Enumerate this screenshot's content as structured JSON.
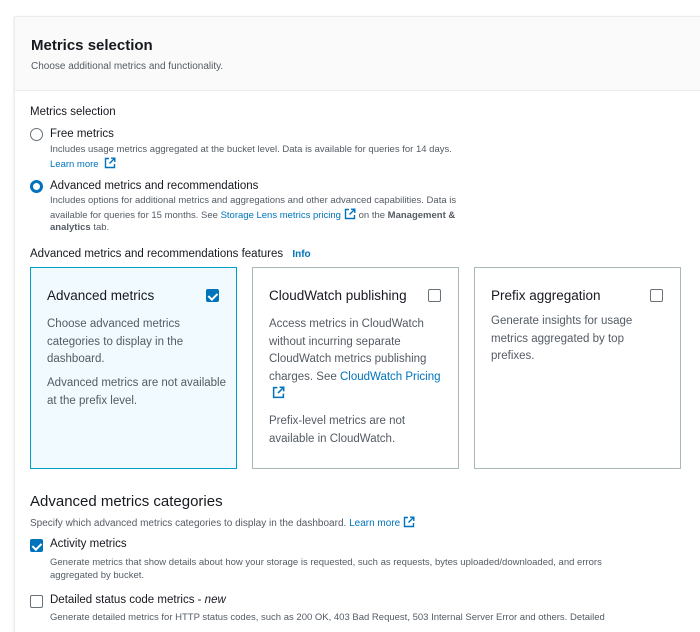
{
  "header": {
    "title": "Metrics selection",
    "description": "Choose additional metrics and functionality."
  },
  "metrics_selection": {
    "label": "Metrics selection",
    "options": [
      {
        "label": "Free metrics",
        "description": "Includes usage metrics aggregated at the bucket level. Data is available for queries for 14 days.",
        "link": "Learn more",
        "selected": false
      },
      {
        "label": "Advanced metrics and recommendations",
        "description_line1": "Includes options for additional metrics and aggregations and other advanced capabilities. Data is",
        "description_line2_pre": "available for queries for 15 months. See",
        "description_link": "Storage Lens metrics pricing",
        "description_line2_post": "on the",
        "description_bold": "Management &",
        "description_line3_bold": "analytics",
        "description_line3_post": "tab.",
        "selected": true
      }
    ]
  },
  "features": {
    "label": "Advanced metrics and recommendations features",
    "info": "Info",
    "tiles": [
      {
        "title": "Advanced metrics",
        "checked": true,
        "body1": "Choose advanced metrics categories to display in the dashboard.",
        "body2": "Advanced metrics are not available at the prefix level."
      },
      {
        "title": "CloudWatch publishing",
        "checked": false,
        "body1_pre": "Access metrics in CloudWatch without incurring separate CloudWatch metrics publishing charges. See",
        "body1_link": "CloudWatch Pricing",
        "body2": "Prefix-level metrics are not available in CloudWatch."
      },
      {
        "title": "Prefix aggregation",
        "checked": false,
        "body1": "Generate insights for usage metrics aggregated by top prefixes."
      }
    ]
  },
  "categories": {
    "title": "Advanced metrics categories",
    "description": "Specify which advanced metrics categories to display in the dashboard.",
    "link": "Learn more",
    "items": [
      {
        "label": "Activity metrics",
        "checked": true,
        "description_line1": "Generate metrics that show details about how your storage is requested, such as requests, bytes uploaded/downloaded, and errors",
        "description_line2": "aggregated by bucket."
      },
      {
        "label": "Detailed status code metrics - ",
        "label_italic": "new",
        "checked": false,
        "description_line1": "Generate detailed metrics for HTTP status codes, such as 200 OK, 403 Bad Request, 503 Internal Server Error and others. Detailed"
      }
    ]
  },
  "colors": {
    "accent": "#0073bb",
    "selected_tile_bg": "#f1faff",
    "selected_tile_border": "#00a1c9"
  }
}
